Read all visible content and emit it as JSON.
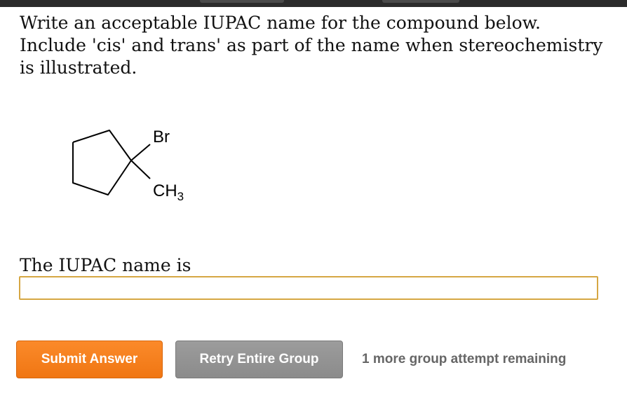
{
  "question": {
    "line1": "Write an acceptable IUPAC name for the compound below.",
    "line2": "Include 'cis' and trans' as part of the name when stereochemistry",
    "line3": "is illustrated."
  },
  "molecule": {
    "substituent_top": "Br",
    "substituent_bottom_main": "CH",
    "substituent_bottom_sub": "3"
  },
  "answer": {
    "label": "The IUPAC name is",
    "value": ""
  },
  "buttons": {
    "submit_label": "Submit Answer",
    "retry_label": "Retry Entire Group"
  },
  "status": {
    "attempts_text": "1 more group attempt remaining"
  },
  "colors": {
    "submit_orange": "#f7801c",
    "retry_gray": "#939393",
    "input_border": "#d6a743"
  }
}
